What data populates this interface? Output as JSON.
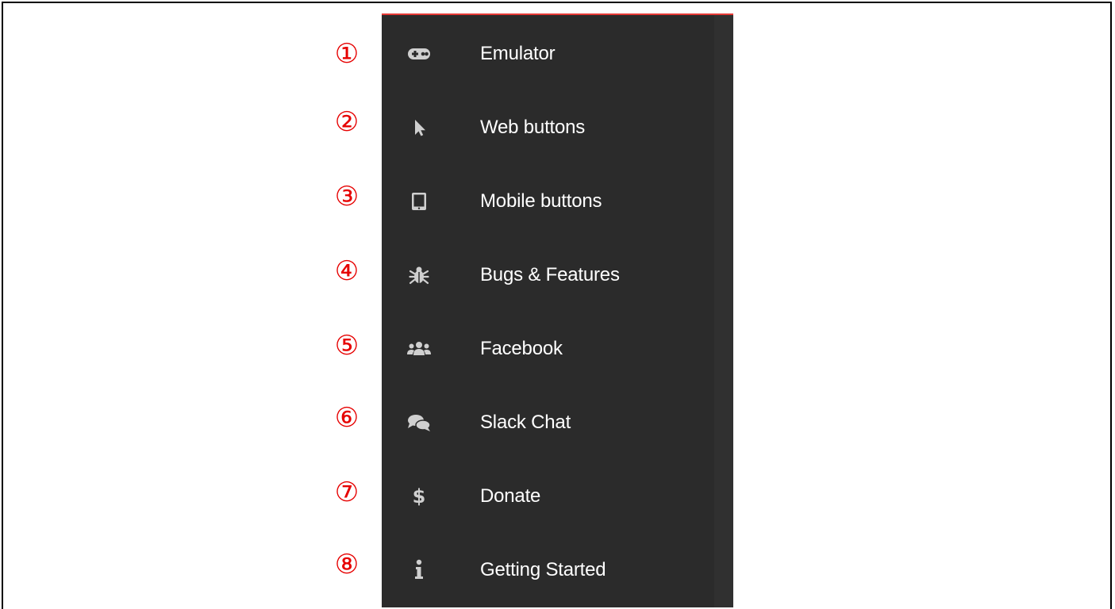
{
  "menu": {
    "items": [
      {
        "label": "Emulator",
        "icon": "gamepad-icon",
        "callout": "①"
      },
      {
        "label": "Web buttons",
        "icon": "mouse-pointer-icon",
        "callout": "②"
      },
      {
        "label": "Mobile buttons",
        "icon": "tablet-icon",
        "callout": "③"
      },
      {
        "label": "Bugs & Features",
        "icon": "bug-icon",
        "callout": "④"
      },
      {
        "label": "Facebook",
        "icon": "users-icon",
        "callout": "⑤"
      },
      {
        "label": "Slack Chat",
        "icon": "chat-bubbles-icon",
        "callout": "⑥"
      },
      {
        "label": "Donate",
        "icon": "dollar-icon",
        "callout": "⑦"
      },
      {
        "label": "Getting Started",
        "icon": "info-icon",
        "callout": "⑧"
      }
    ]
  },
  "colors": {
    "panel_background": "#2b2b2b",
    "text": "#ffffff",
    "icon": "#cfcfcf",
    "callout": "#e60000",
    "accent": "#e53935"
  }
}
